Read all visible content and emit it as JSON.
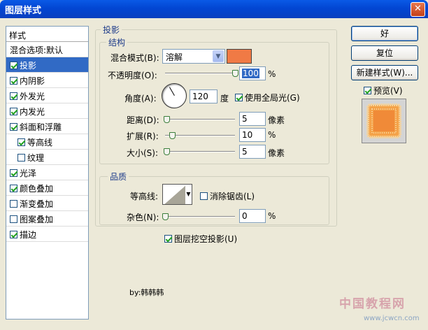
{
  "window": {
    "title": "图层样式",
    "close_glyph": "✕"
  },
  "style_list": {
    "header": "样式",
    "items": [
      {
        "label": "混合选项:默认",
        "checkbox": false,
        "checked": false,
        "selected": false,
        "indent": false
      },
      {
        "label": "投影",
        "checkbox": true,
        "checked": true,
        "selected": true,
        "indent": false
      },
      {
        "label": "内阴影",
        "checkbox": true,
        "checked": true,
        "selected": false,
        "indent": false
      },
      {
        "label": "外发光",
        "checkbox": true,
        "checked": true,
        "selected": false,
        "indent": false
      },
      {
        "label": "内发光",
        "checkbox": true,
        "checked": true,
        "selected": false,
        "indent": false
      },
      {
        "label": "斜面和浮雕",
        "checkbox": true,
        "checked": true,
        "selected": false,
        "indent": false
      },
      {
        "label": "等高线",
        "checkbox": true,
        "checked": true,
        "selected": false,
        "indent": true
      },
      {
        "label": "纹理",
        "checkbox": true,
        "checked": false,
        "selected": false,
        "indent": true
      },
      {
        "label": "光泽",
        "checkbox": true,
        "checked": true,
        "selected": false,
        "indent": false
      },
      {
        "label": "颜色叠加",
        "checkbox": true,
        "checked": true,
        "selected": false,
        "indent": false
      },
      {
        "label": "渐变叠加",
        "checkbox": true,
        "checked": false,
        "selected": false,
        "indent": false
      },
      {
        "label": "图案叠加",
        "checkbox": true,
        "checked": false,
        "selected": false,
        "indent": false
      },
      {
        "label": "描边",
        "checkbox": true,
        "checked": true,
        "selected": false,
        "indent": false
      }
    ]
  },
  "drop_shadow": {
    "group_title": "投影",
    "structure": {
      "title": "结构",
      "blend_mode_label": "混合模式(B):",
      "blend_mode_value": "溶解",
      "blend_color": "#f07a45",
      "opacity_label": "不透明度(O):",
      "opacity_value": "100",
      "opacity_unit": "%",
      "opacity_fraction": 1.0,
      "angle_label": "角度(A):",
      "angle_value": "120",
      "angle_unit": "度",
      "global_light_label": "使用全局光(G)",
      "global_light_checked": true,
      "distance_label": "距离(D):",
      "distance_value": "5",
      "distance_unit": "像素",
      "distance_fraction": 0.02,
      "spread_label": "扩展(R):",
      "spread_value": "10",
      "spread_unit": "%",
      "spread_fraction": 0.1,
      "size_label": "大小(S):",
      "size_value": "5",
      "size_unit": "像素",
      "size_fraction": 0.02
    },
    "quality": {
      "title": "品质",
      "contour_label": "等高线:",
      "antialias_label": "消除锯齿(L)",
      "antialias_checked": false,
      "noise_label": "杂色(N):",
      "noise_value": "0",
      "noise_unit": "%",
      "noise_fraction": 0.0
    },
    "knockout_label": "图层挖空投影(U)",
    "knockout_checked": true
  },
  "buttons": {
    "ok": "好",
    "reset": "复位",
    "new_style": "新建样式(W)...",
    "preview_label": "预览(V)",
    "preview_checked": true
  },
  "credit": "by:韩韩韩",
  "watermark": {
    "text": "中国教程网",
    "url": "www.jcwcn.com"
  },
  "colors": {
    "accent_selection": "#316ac5",
    "title_bar": "#0246d3",
    "dialog_bg": "#ece9d8"
  }
}
